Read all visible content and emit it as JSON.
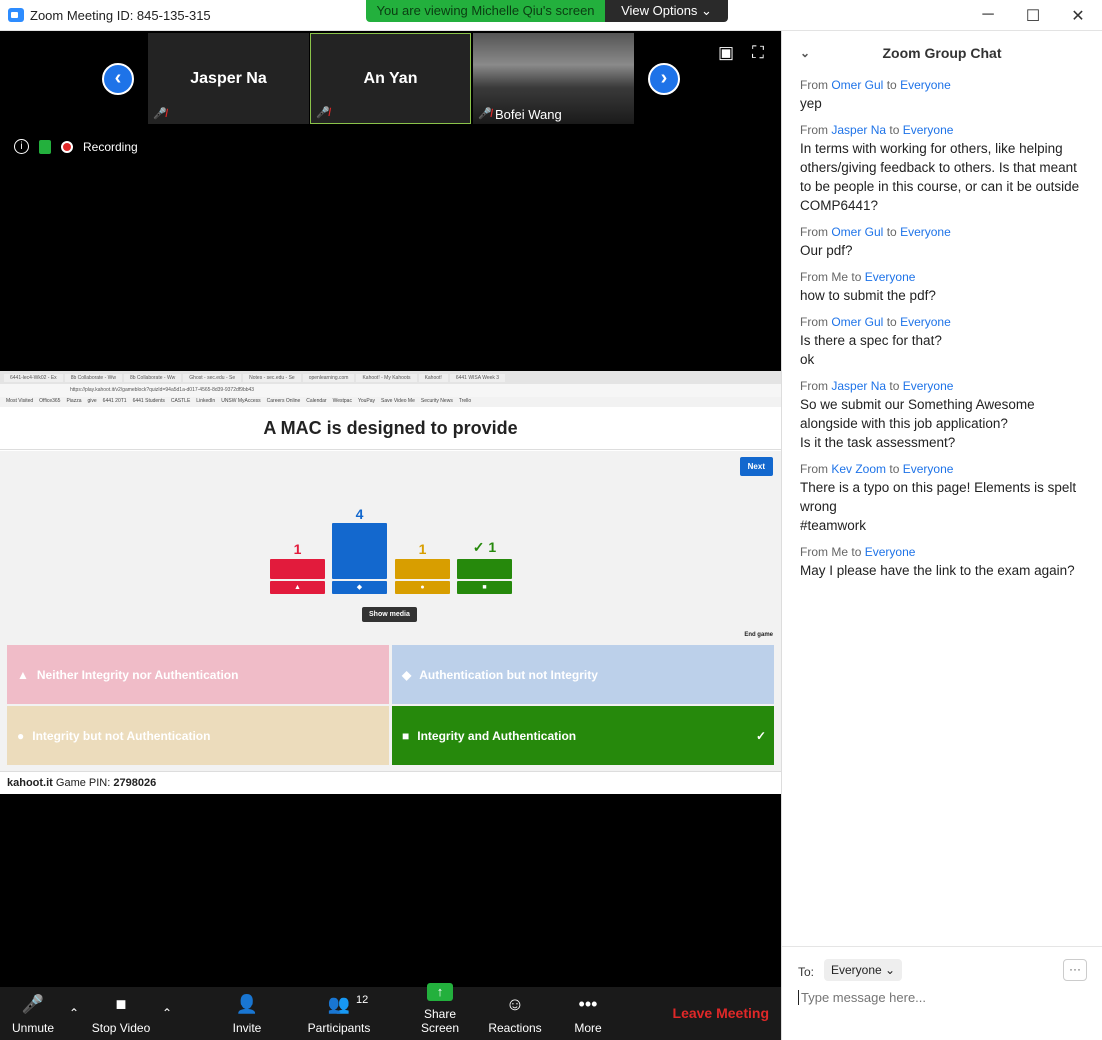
{
  "window": {
    "title": "Zoom Meeting ID: 845-135-315",
    "minimize": "─",
    "maximize": "☐",
    "close": "✕"
  },
  "share_banner": {
    "viewing": "You are viewing Michelle Qiu's screen",
    "view_options": "View Options ⌄"
  },
  "participants_strip": {
    "tiles": [
      {
        "name": "Jasper Na"
      },
      {
        "name": "An Yan"
      },
      {
        "name": "Bofei Wang"
      }
    ]
  },
  "recording": {
    "label": "Recording"
  },
  "browser": {
    "tabs": [
      "6441-lec4-Wk02 - Ex",
      "8b Collaborate - Ww",
      "8b Collaborate - Ww",
      "Ghost - sec.edu - Se",
      "Notes - sec.edu - Se",
      "openlearning.com",
      "Kahoot! - My Kahoots",
      "Kahoot!",
      "6441 WISA Week 3"
    ],
    "url": "https://play.kahoot.it/v2/gameblock?quizId=94a5d1a-d017-4565-8d39-9372df9bb43",
    "bookmarks": [
      "Most Visited",
      "Office365",
      "Piazza",
      "give",
      "6441 20T1",
      "6441 Students",
      "CASTLE",
      "LinkedIn",
      "UNSW MyAccess",
      "Careers Online",
      "Calendar",
      "Westpac",
      "YouPay",
      "Save Video Me",
      "Security News",
      "Trello"
    ]
  },
  "kahoot": {
    "question": "A MAC is designed to provide",
    "next": "Next",
    "show_media": "Show media",
    "end_game": "End game",
    "results": [
      {
        "count": "1",
        "color": "#e21b3c",
        "symbol": "▲"
      },
      {
        "count": "4",
        "color": "#1368ce",
        "symbol": "◆"
      },
      {
        "count": "1",
        "color": "#d89e00",
        "symbol": "●"
      },
      {
        "count": "✓ 1",
        "color": "#26890c",
        "symbol": "■"
      }
    ],
    "answers": [
      {
        "text": "Neither Integrity nor Authentication",
        "symbol": "▲",
        "color": "#f0bcc8"
      },
      {
        "text": "Authentication but not Integrity",
        "symbol": "◆",
        "color": "#bcd0ea"
      },
      {
        "text": "Integrity but not Authentication",
        "symbol": "●",
        "color": "#ecdcbc"
      },
      {
        "text": "Integrity and Authentication",
        "symbol": "■",
        "color": "#26890c",
        "check": "✓"
      }
    ],
    "footer_brand": "kahoot.it",
    "footer_pin_label": "Game PIN:",
    "footer_pin": "2798026"
  },
  "toolbar": {
    "unmute": "Unmute",
    "stop_video": "Stop Video",
    "invite": "Invite",
    "participants": "Participants",
    "participants_count": "12",
    "share_screen": "Share Screen",
    "reactions": "Reactions",
    "more": "More",
    "leave": "Leave Meeting"
  },
  "chat": {
    "title": "Zoom Group Chat",
    "messages": [
      {
        "from": "Omer Gul",
        "to": "Everyone",
        "text": "yep"
      },
      {
        "from": "Jasper Na",
        "to": "Everyone",
        "text": "In terms with working for others, like helping others/giving feedback to others. Is that meant to be people in this course, or can it be outside COMP6441?"
      },
      {
        "from": "Omer Gul",
        "to": "Everyone",
        "text": "Our pdf?"
      },
      {
        "from": "Me",
        "to": "Everyone",
        "text": "how to submit the pdf?"
      },
      {
        "from": "Omer Gul",
        "to": "Everyone",
        "text": "Is there a spec for that?\nok"
      },
      {
        "from": "Jasper Na",
        "to": "Everyone",
        "text": "So we submit our Something Awesome alongside with this job application?\nIs it the task assessment?"
      },
      {
        "from": "Kev Zoom",
        "to": "Everyone",
        "text": "There is a typo on this page! Elements is spelt wrong\n#teamwork"
      },
      {
        "from": "Me",
        "to": "Everyone",
        "text": "May I please have the link to the exam again?"
      }
    ],
    "from_word": "From",
    "to_word": "to",
    "to_label": "To:",
    "to_value": "Everyone ⌄",
    "placeholder": "Type message here...",
    "more": "···"
  }
}
